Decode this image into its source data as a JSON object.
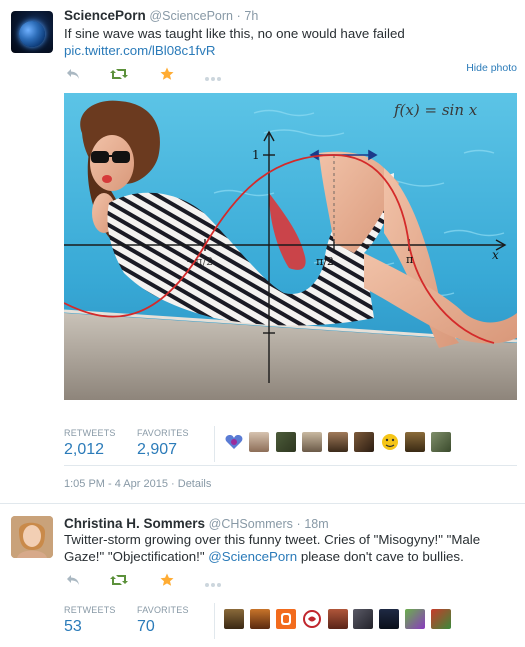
{
  "tweet1": {
    "author_name": "SciencePorn",
    "author_handle": "@SciencePorn",
    "separator": "·",
    "timestamp": "7h",
    "text": "If sine wave was taught like this, no one would have failed",
    "link": "pic.twitter.com/lBl08c1fvR",
    "hide_photo_label": "Hide photo",
    "retweets_label": "RETWEETS",
    "retweets_count": "2,012",
    "favorites_label": "FAVORITES",
    "favorites_count": "2,907",
    "posted_at": "1:05 PM - 4 Apr 2015",
    "details_sep": "·",
    "details_label": "Details",
    "photo_labels": {
      "formula": "f(x) = sin x",
      "y_one": "1",
      "x_half_pi": "π/2",
      "x_pi": "π",
      "x_var": "x",
      "x_neg_half_pi": "−π/2"
    }
  },
  "tweet2": {
    "author_name": "Christina H. Sommers",
    "author_handle": "@CHSommers",
    "separator": "·",
    "timestamp": "18m",
    "text_line1": "Twitter-storm growing over this funny tweet. Cries of \"Misogyny!\" \"Male",
    "text_line2_part1": "Gaze!\" \"Objectification!\" ",
    "text_line2_mention": "@SciencePorn",
    "text_line2_part2": " please don't cave to bullies.",
    "retweets_label": "RETWEETS",
    "retweets_count": "53",
    "favorites_label": "FAVORITES",
    "favorites_count": "70"
  },
  "colors": {
    "link": "#2b7bb9",
    "retweet_green": "#5c913b",
    "favorite_orange": "#ffac33",
    "muted": "#8899a6",
    "border": "#e1e8ed"
  },
  "icons": [
    "reply-icon",
    "retweet-icon",
    "favorite-icon",
    "more-icon"
  ]
}
